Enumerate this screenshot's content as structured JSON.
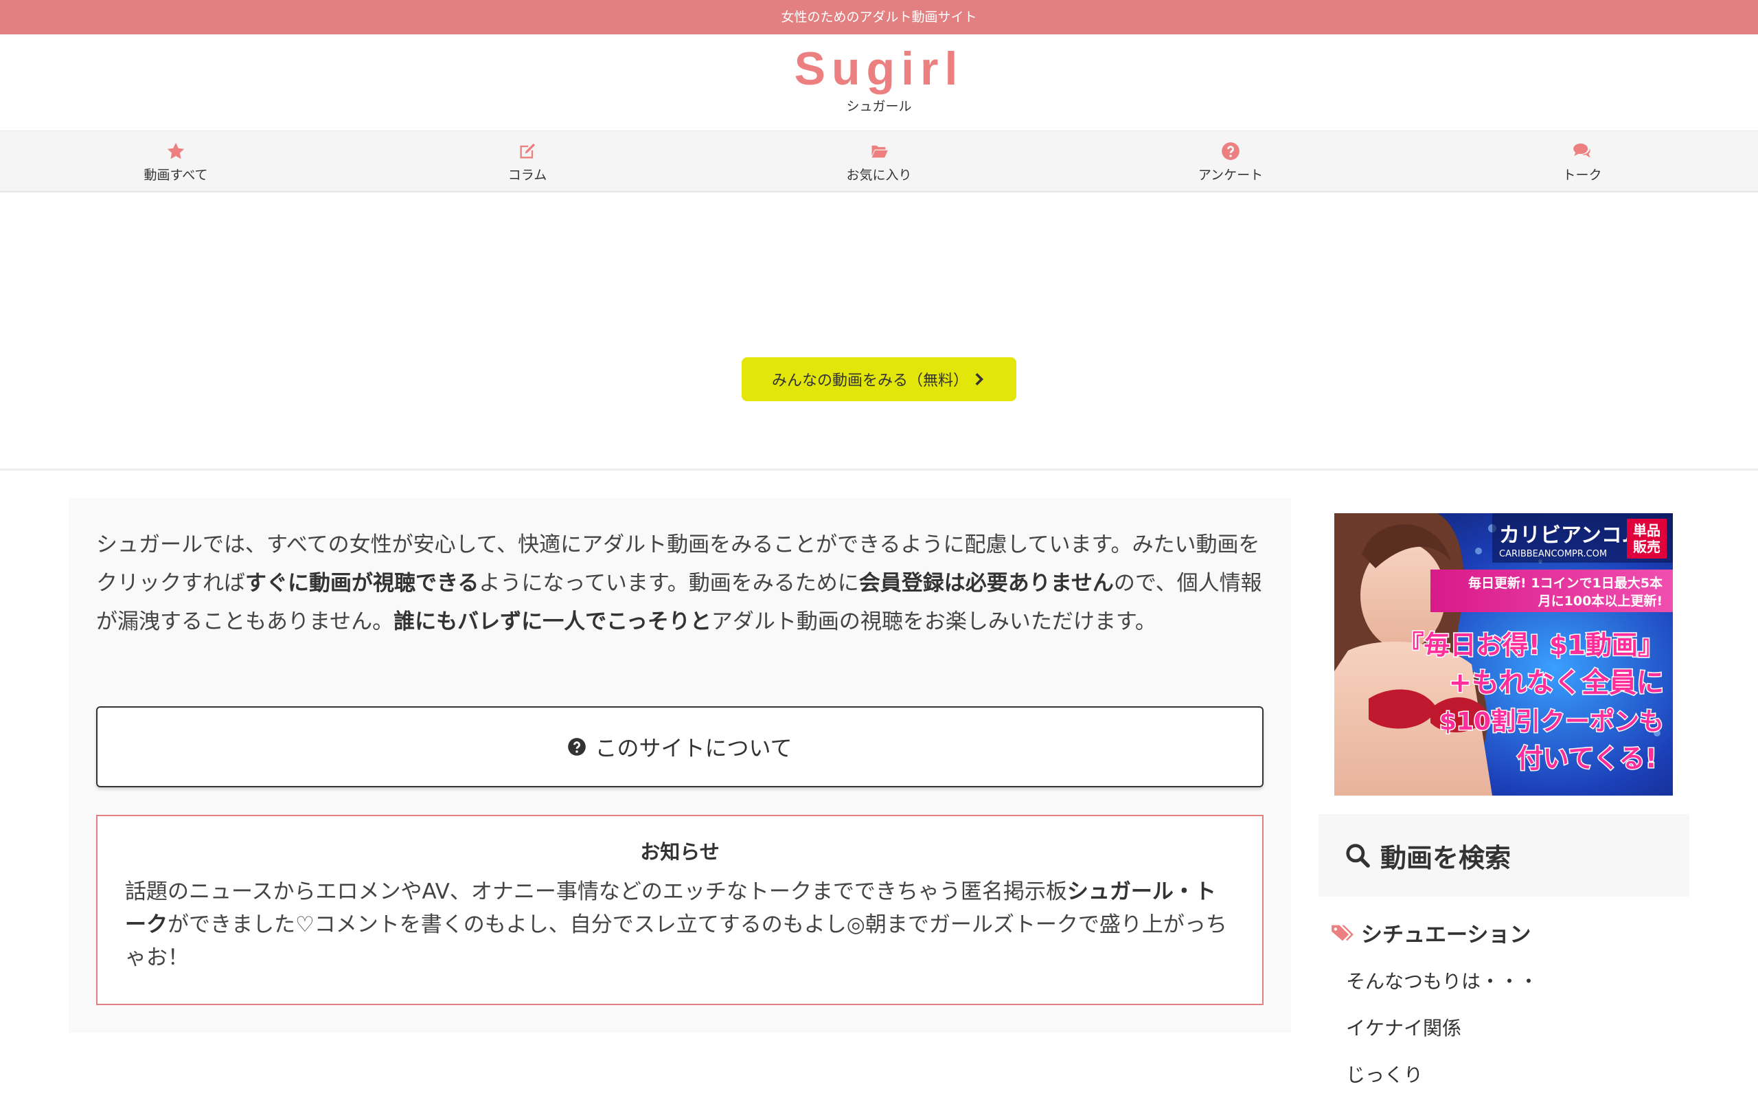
{
  "topbar": {
    "text": "女性のためのアダルト動画サイト"
  },
  "header": {
    "logo": "Sugirl",
    "subtitle": "シュガール"
  },
  "nav": {
    "items": [
      {
        "label": "動画すべて",
        "icon": "star-icon"
      },
      {
        "label": "コラム",
        "icon": "edit-icon"
      },
      {
        "label": "お気に入り",
        "icon": "folder-open-icon"
      },
      {
        "label": "アンケート",
        "icon": "question-circle-icon"
      },
      {
        "label": "トーク",
        "icon": "comments-icon"
      }
    ]
  },
  "hero": {
    "button_label": "みんなの動画をみる（無料）"
  },
  "intro": {
    "p1": "シュガールでは、すべての女性が安心して、快適にアダルト動画をみることができるように配慮しています。みたい動画をクリックすれば",
    "b1": "すぐに動画が視聴できる",
    "p2": "ようになっています。動画をみるために",
    "b2": "会員登録は必要ありません",
    "p3": "ので、個人情報が漏洩することもありません。",
    "b3": "誰にもバレずに一人でこっそりと",
    "p4": "アダルト動画の視聴をお楽しみいただけます。"
  },
  "about": {
    "label": "このサイトについて"
  },
  "notice": {
    "title": "お知らせ",
    "p1": "話題のニュースからエロメンやAV、オナニー事情などのエッチなトークまでできちゃう匿名掲示板",
    "b1": "シュガール・トーク",
    "p2": "ができました♡コメントを書くのもよし、自分でスレ立てするのもよし◎朝までガールズトークで盛り上がっちゃお！"
  },
  "banner": {
    "brand": "カリビアンコム",
    "badge": "単品販売",
    "domain": "CARIBBEANCOMPR.COM",
    "line1": "毎日更新! 1コインで1日最大5本",
    "line2": "月に100本以上更新!",
    "headline1": "『毎日お得! $1動画』",
    "headline2": "+もれなく全員に",
    "headline3": "$10割引クーポンも",
    "headline4": "付いてくる!"
  },
  "sidebar": {
    "search_title": "動画を検索",
    "situation_title": "シチュエーション",
    "categories": [
      "そんなつもりは・・・",
      "イケナイ関係",
      "じっくり"
    ]
  },
  "colors": {
    "accent": "#e27f80",
    "hero_button": "#e3e60a"
  }
}
